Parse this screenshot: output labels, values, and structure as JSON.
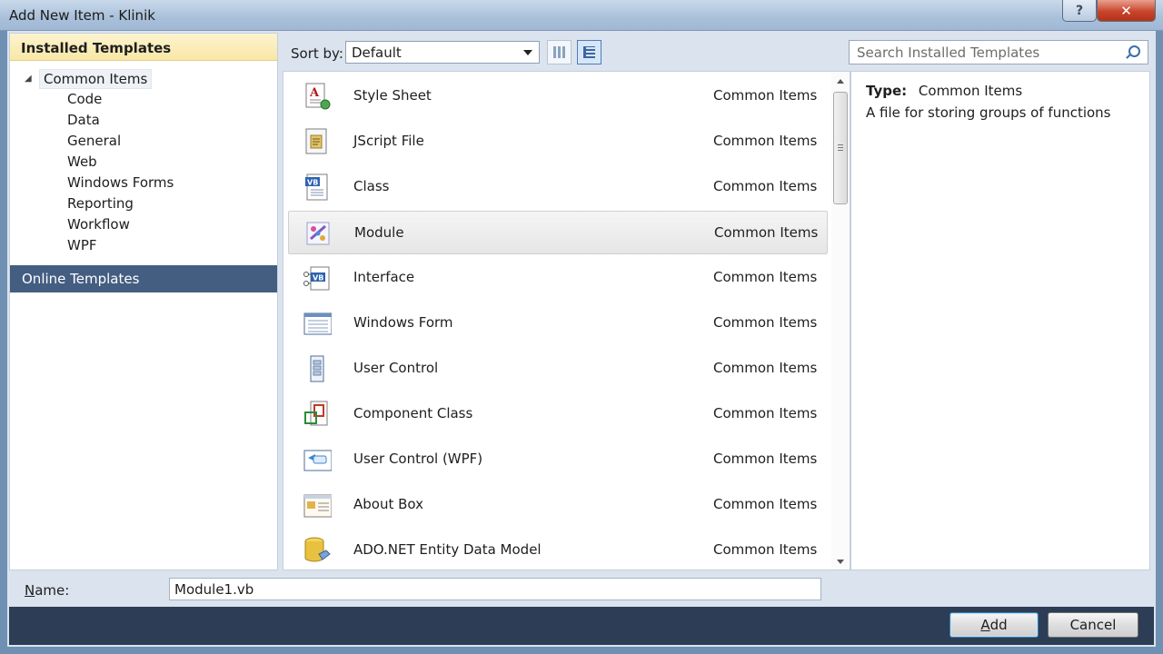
{
  "window": {
    "title": "Add New Item - Klinik",
    "help_glyph": "?",
    "close_glyph": "✕"
  },
  "left": {
    "installed_label": "Installed Templates",
    "root_label": "Common Items",
    "children": [
      "Code",
      "Data",
      "General",
      "Web",
      "Windows Forms",
      "Reporting",
      "Workflow",
      "WPF"
    ],
    "online_label": "Online Templates"
  },
  "toolbar": {
    "sort_label": "Sort by:",
    "sort_value": "Default"
  },
  "search": {
    "placeholder": "Search Installed Templates"
  },
  "items": [
    {
      "name": "Style Sheet",
      "category": "Common Items",
      "icon": "style-sheet-icon"
    },
    {
      "name": "JScript File",
      "category": "Common Items",
      "icon": "jscript-file-icon"
    },
    {
      "name": "Class",
      "category": "Common Items",
      "icon": "vb-class-icon"
    },
    {
      "name": "Module",
      "category": "Common Items",
      "icon": "module-icon"
    },
    {
      "name": "Interface",
      "category": "Common Items",
      "icon": "interface-icon"
    },
    {
      "name": "Windows Form",
      "category": "Common Items",
      "icon": "windows-form-icon"
    },
    {
      "name": "User Control",
      "category": "Common Items",
      "icon": "user-control-icon"
    },
    {
      "name": "Component Class",
      "category": "Common Items",
      "icon": "component-class-icon"
    },
    {
      "name": "User Control (WPF)",
      "category": "Common Items",
      "icon": "wpf-user-control-icon"
    },
    {
      "name": "About Box",
      "category": "Common Items",
      "icon": "about-box-icon"
    },
    {
      "name": "ADO.NET Entity Data Model",
      "category": "Common Items",
      "icon": "entity-data-model-icon"
    }
  ],
  "details": {
    "type_label": "Type:",
    "type_value": "Common Items",
    "description": "A file for storing groups of functions"
  },
  "bottom": {
    "name_label_accel": "N",
    "name_label_rest": "ame:",
    "name_value": "Module1.vb"
  },
  "buttons": {
    "add_accel": "A",
    "add_rest": "dd",
    "cancel": "Cancel"
  },
  "colors": {
    "selected_header": "#445e82",
    "installed_header": "#f8e7a7",
    "footer": "#2c3d55"
  }
}
